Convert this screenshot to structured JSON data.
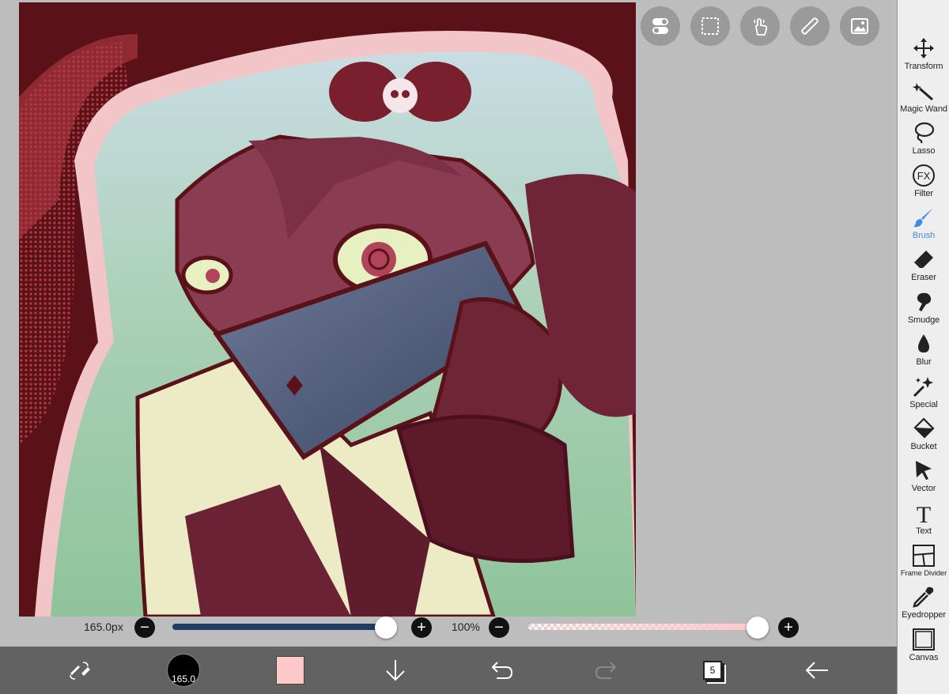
{
  "toolbar": {
    "tools": [
      {
        "id": "transform",
        "label": "Transform",
        "icon": "move-icon"
      },
      {
        "id": "magic-wand",
        "label": "Magic Wand",
        "icon": "magic-wand-icon"
      },
      {
        "id": "lasso",
        "label": "Lasso",
        "icon": "lasso-icon"
      },
      {
        "id": "filter",
        "label": "Filter",
        "icon": "fx-icon"
      },
      {
        "id": "brush",
        "label": "Brush",
        "icon": "brush-icon"
      },
      {
        "id": "eraser",
        "label": "Eraser",
        "icon": "eraser-icon"
      },
      {
        "id": "smudge",
        "label": "Smudge",
        "icon": "smudge-icon"
      },
      {
        "id": "blur",
        "label": "Blur",
        "icon": "drop-icon"
      },
      {
        "id": "special",
        "label": "Special",
        "icon": "sparkle-icon"
      },
      {
        "id": "bucket",
        "label": "Bucket",
        "icon": "bucket-icon"
      },
      {
        "id": "vector",
        "label": "Vector",
        "icon": "cursor-icon"
      },
      {
        "id": "text",
        "label": "Text",
        "icon": "text-icon"
      },
      {
        "id": "frame-divider",
        "label": "Frame Divider",
        "icon": "frame-divider-icon"
      },
      {
        "id": "eyedropper",
        "label": "Eyedropper",
        "icon": "eyedropper-icon"
      },
      {
        "id": "canvas",
        "label": "Canvas",
        "icon": "canvas-icon"
      }
    ],
    "active_tool": "brush"
  },
  "sliders": {
    "size_label": "165.0px",
    "size_fraction": 0.98,
    "opacity_label": "100%",
    "opacity_fraction": 1.0
  },
  "bottom": {
    "brush_size_text": "165.0",
    "current_color": "#ffc8c8",
    "layer_count": "5"
  },
  "colors": {
    "accent_blue": "#3b8de0",
    "size_track": "#1f3d63",
    "canvas_bg": "#5a1218"
  }
}
